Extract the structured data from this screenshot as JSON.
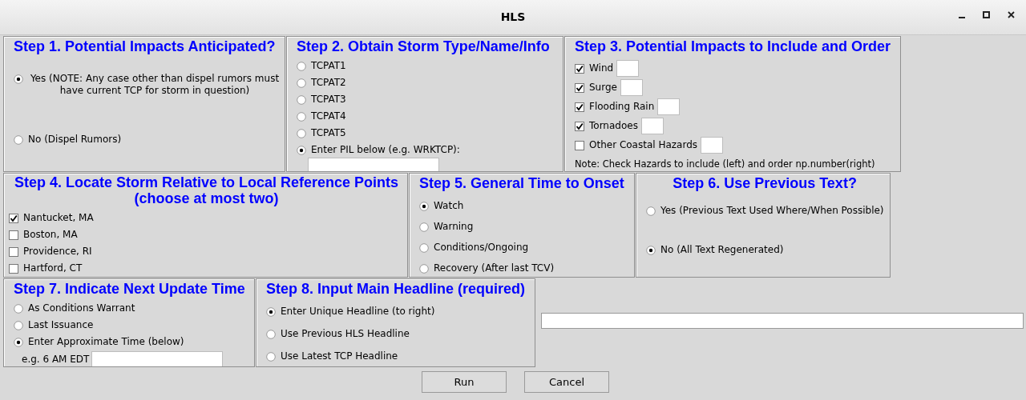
{
  "window": {
    "title": "HLS"
  },
  "rows": [
    {
      "steps": [
        {
          "kind": "spread",
          "title": "Step 1. Potential Impacts Anticipated?",
          "options": [
            {
              "kind": "radio",
              "label": "Yes (NOTE: Any case other than dispel rumors must have current TCP for storm in question)",
              "selected": true
            },
            {
              "kind": "radio",
              "label": "No (Dispel Rumors)",
              "selected": false
            }
          ]
        },
        {
          "kind": "pil",
          "title": "Step 2. Obtain Storm Type/Name/Info",
          "options": [
            {
              "kind": "radio",
              "label": "TCPAT1",
              "selected": false
            },
            {
              "kind": "radio",
              "label": "TCPAT2",
              "selected": false
            },
            {
              "kind": "radio",
              "label": "TCPAT3",
              "selected": false
            },
            {
              "kind": "radio",
              "label": "TCPAT4",
              "selected": false
            },
            {
              "kind": "radio",
              "label": "TCPAT5",
              "selected": false
            },
            {
              "kind": "radio",
              "label": "Enter PIL below (e.g. WRKTCP):",
              "selected": true
            }
          ]
        },
        {
          "kind": "hazards",
          "title": "Step 3. Potential Impacts to Include and Order",
          "options": [
            {
              "kind": "ordered_checkbox",
              "label": "Wind",
              "checked": true
            },
            {
              "kind": "ordered_checkbox",
              "label": "Surge",
              "checked": true
            },
            {
              "kind": "ordered_checkbox",
              "label": "Flooding Rain",
              "checked": true
            },
            {
              "kind": "ordered_checkbox",
              "label": "Tornadoes",
              "checked": true
            },
            {
              "kind": "ordered_checkbox",
              "label": "Other Coastal Hazards",
              "checked": false
            }
          ],
          "note": "Note: Check Hazards to include (left) and order np.number(right)"
        }
      ]
    },
    {
      "steps": [
        {
          "kind": "points",
          "title": "Step 4. Locate Storm Relative to Local Reference Points (choose at most two)",
          "options": [
            {
              "kind": "checkbox",
              "label": "Nantucket, MA",
              "checked": true
            },
            {
              "kind": "checkbox",
              "label": "Boston, MA",
              "checked": false
            },
            {
              "kind": "checkbox",
              "label": "Providence, RI",
              "checked": false
            },
            {
              "kind": "checkbox",
              "label": "Hartford, CT",
              "checked": false
            }
          ]
        },
        {
          "kind": "list",
          "title": "Step 5. General Time to Onset",
          "options": [
            {
              "kind": "radio",
              "label": "Watch",
              "selected": true
            },
            {
              "kind": "radio",
              "label": "Warning",
              "selected": false
            },
            {
              "kind": "radio",
              "label": "Conditions/Ongoing",
              "selected": false
            },
            {
              "kind": "radio",
              "label": "Recovery (After last TCV)",
              "selected": false
            }
          ]
        },
        {
          "kind": "spread",
          "title": "Step 6. Use Previous Text?",
          "options": [
            {
              "kind": "radio",
              "label": "Yes (Previous Text Used Where/When Possible)",
              "selected": false
            },
            {
              "kind": "radio",
              "label": "No (All Text Regenerated)",
              "selected": true
            }
          ]
        }
      ]
    },
    {
      "steps": [
        {
          "kind": "time",
          "title": "Step 7. Indicate Next Update Time",
          "options": [
            {
              "kind": "radio",
              "label": "As Conditions Warrant",
              "selected": false
            },
            {
              "kind": "radio",
              "label": "Last Issuance",
              "selected": false
            },
            {
              "kind": "radio",
              "label": "Enter Approximate Time (below)",
              "selected": true
            }
          ],
          "hint": "e.g. 6 AM EDT"
        },
        {
          "kind": "headline",
          "title": "Step 8. Input Main Headline (required)",
          "options": [
            {
              "kind": "radio",
              "label": "Enter Unique Headline (to right)",
              "selected": true
            },
            {
              "kind": "radio",
              "label": "Use Previous HLS Headline",
              "selected": false
            },
            {
              "kind": "radio",
              "label": "Use Latest TCP Headline",
              "selected": false
            }
          ]
        }
      ]
    }
  ],
  "buttons": [
    "Run",
    "Cancel"
  ]
}
